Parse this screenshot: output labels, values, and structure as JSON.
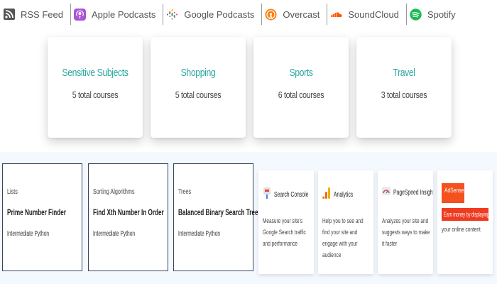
{
  "podcasts": [
    {
      "label": "RSS Feed",
      "icon": "rss-icon"
    },
    {
      "label": "Apple Podcasts",
      "icon": "apple-podcasts-icon"
    },
    {
      "label": "Google Podcasts",
      "icon": "google-podcasts-icon"
    },
    {
      "label": "Overcast",
      "icon": "overcast-icon"
    },
    {
      "label": "SoundCloud",
      "icon": "soundcloud-icon"
    },
    {
      "label": "Spotify",
      "icon": "spotify-icon"
    }
  ],
  "categories": [
    {
      "title": "Sensitive Subjects",
      "count": "5 total courses"
    },
    {
      "title": "Shopping",
      "count": "5 total courses"
    },
    {
      "title": "Sports",
      "count": "6 total courses"
    },
    {
      "title": "Travel",
      "count": "3 total courses"
    }
  ],
  "courses": [
    {
      "category": "Lists",
      "title": "Prime Number Finder",
      "level": "Intermediate Python"
    },
    {
      "category": "Sorting Algorithms",
      "title": "Find Xth Number In Order",
      "level": "Intermediate Python"
    },
    {
      "category": "Trees",
      "title": "Balanced Binary Search Tree",
      "level": "Intermediate Python"
    }
  ],
  "tools": [
    {
      "name": "Search Console",
      "icon": "search-console-icon",
      "description": "Measure your site's Google Search traffic and performance"
    },
    {
      "name": "Analytics",
      "icon": "analytics-icon",
      "description": "Help you to see and find your site and engage with your audience"
    },
    {
      "name": "PageSpeed Insights",
      "icon": "pagespeed-icon",
      "description": "Analyzes your site and suggests ways to make it faster"
    },
    {
      "name": "AdSense",
      "icon": "adsense-icon",
      "description_highlight": "Earn money by displaying ads from",
      "description": "your online content"
    }
  ],
  "colors": {
    "accent_teal": "#2aa89f",
    "adsense_red": "#ef3b22",
    "apple_purple": "#a855d6",
    "overcast_orange": "#fc7e0f",
    "soundcloud_orange": "#ff5500",
    "spotify_green": "#1db954"
  }
}
